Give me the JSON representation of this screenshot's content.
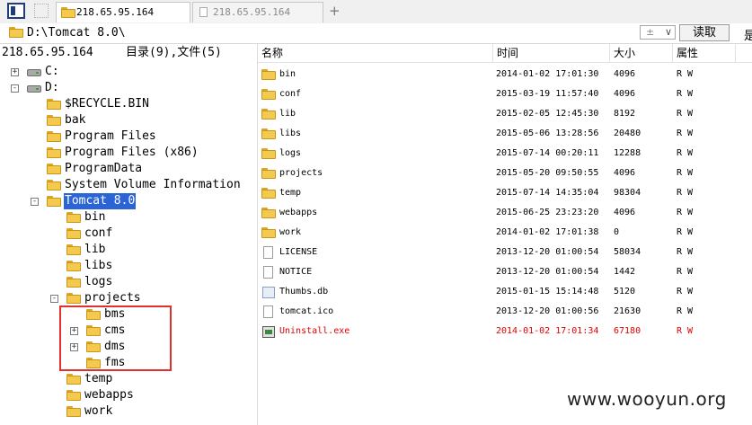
{
  "tabs": [
    {
      "label": "218.65.95.164",
      "active": true
    },
    {
      "label": "218.65.95.164",
      "active": false
    }
  ],
  "new_tab_symbol": "+",
  "path": "D:\\Tomcat 8.0\\",
  "sort_control": {
    "value": "±",
    "chevron": "∨"
  },
  "read_button": "读取",
  "right_cut_text": "是",
  "info": {
    "ip": "218.65.95.164",
    "counts": "目录(9),文件(5)"
  },
  "columns": {
    "name": "名称",
    "time": "时间",
    "size": "大小",
    "attr": "属性"
  },
  "tree": [
    {
      "label": "C:",
      "type": "drive",
      "expander": "+"
    },
    {
      "label": "D:",
      "type": "drive",
      "expander": "-"
    },
    {
      "label": "$RECYCLE.BIN",
      "type": "folder",
      "expander": ""
    },
    {
      "label": "bak",
      "type": "folder",
      "expander": ""
    },
    {
      "label": "Program Files",
      "type": "folder",
      "expander": ""
    },
    {
      "label": "Program Files (x86)",
      "type": "folder",
      "expander": ""
    },
    {
      "label": "ProgramData",
      "type": "folder",
      "expander": ""
    },
    {
      "label": "System Volume Information",
      "type": "folder",
      "expander": ""
    },
    {
      "label": "Tomcat 8.0",
      "type": "folder",
      "expander": "-",
      "selected": true
    },
    {
      "label": "bin",
      "type": "folder",
      "expander": ""
    },
    {
      "label": "conf",
      "type": "folder",
      "expander": ""
    },
    {
      "label": "lib",
      "type": "folder",
      "expander": ""
    },
    {
      "label": "libs",
      "type": "folder",
      "expander": ""
    },
    {
      "label": "logs",
      "type": "folder",
      "expander": ""
    },
    {
      "label": "projects",
      "type": "folder",
      "expander": "-"
    },
    {
      "label": "bms",
      "type": "folder",
      "expander": ""
    },
    {
      "label": "cms",
      "type": "folder",
      "expander": "+"
    },
    {
      "label": "dms",
      "type": "folder",
      "expander": "+"
    },
    {
      "label": "fms",
      "type": "folder",
      "expander": ""
    },
    {
      "label": "temp",
      "type": "folder",
      "expander": ""
    },
    {
      "label": "webapps",
      "type": "folder",
      "expander": ""
    },
    {
      "label": "work",
      "type": "folder",
      "expander": ""
    }
  ],
  "files": [
    {
      "name": "bin",
      "icon": "folder-icon",
      "time": "2014-01-02 17:01:30",
      "size": "4096",
      "attr": "R W"
    },
    {
      "name": "conf",
      "icon": "folder-icon",
      "time": "2015-03-19 11:57:40",
      "size": "4096",
      "attr": "R W"
    },
    {
      "name": "lib",
      "icon": "folder-icon",
      "time": "2015-02-05 12:45:30",
      "size": "8192",
      "attr": "R W"
    },
    {
      "name": "libs",
      "icon": "folder-icon",
      "time": "2015-05-06 13:28:56",
      "size": "20480",
      "attr": "R W"
    },
    {
      "name": "logs",
      "icon": "folder-icon",
      "time": "2015-07-14 00:20:11",
      "size": "12288",
      "attr": "R W"
    },
    {
      "name": "projects",
      "icon": "folder-icon",
      "time": "2015-05-20 09:50:55",
      "size": "4096",
      "attr": "R W"
    },
    {
      "name": "temp",
      "icon": "folder-icon",
      "time": "2015-07-14 14:35:04",
      "size": "98304",
      "attr": "R W"
    },
    {
      "name": "webapps",
      "icon": "folder-icon",
      "time": "2015-06-25 23:23:20",
      "size": "4096",
      "attr": "R W"
    },
    {
      "name": "work",
      "icon": "folder-icon",
      "time": "2014-01-02 17:01:38",
      "size": "0",
      "attr": "R W"
    },
    {
      "name": "LICENSE",
      "icon": "document-icon",
      "time": "2013-12-20 01:00:54",
      "size": "58034",
      "attr": "R W"
    },
    {
      "name": "NOTICE",
      "icon": "document-icon",
      "time": "2013-12-20 01:00:54",
      "size": "1442",
      "attr": "R W"
    },
    {
      "name": "Thumbs.db",
      "icon": "database-file-icon",
      "time": "2015-01-15 15:14:48",
      "size": "5120",
      "attr": "R W"
    },
    {
      "name": "tomcat.ico",
      "icon": "document-icon",
      "time": "2013-12-20 01:00:56",
      "size": "21630",
      "attr": "R W"
    },
    {
      "name": "Uninstall.exe",
      "icon": "executable-icon",
      "time": "2014-01-02 17:01:34",
      "size": "67180",
      "attr": "R W",
      "highlight": true
    }
  ],
  "watermark": "www.wooyun.org",
  "colors": {
    "selection": "#2a64d6",
    "highlight_red": "#e00000",
    "annotation_box": "#e03030",
    "folder": "#f3c94e"
  }
}
